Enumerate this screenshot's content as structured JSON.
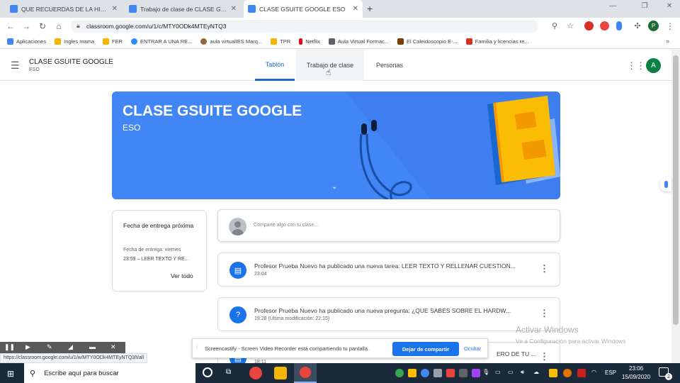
{
  "browser": {
    "tabs": [
      {
        "title": "QUE RECUERDAS DE LA HISTORIA",
        "color": "#4285f4"
      },
      {
        "title": "Trabajo de clase de CLASE GSUITE",
        "color": "#4285f4"
      },
      {
        "title": "CLASE GSUITE GOOGLE ESO",
        "color": "#4285f4"
      }
    ],
    "new_tab": "+",
    "url": "classroom.google.com/u/1/c/MTY0ODk4MTEyNTQ3",
    "profile_initial": "P",
    "bookmarks": [
      {
        "label": "Aplicaciones",
        "color": "#4285f4"
      },
      {
        "label": "Ingles mama",
        "color": "#f4b400"
      },
      {
        "label": "FER",
        "color": "#f4b400"
      },
      {
        "label": "ENTRAR A UNA RE...",
        "color": "#2d8cff"
      },
      {
        "label": "aula virtualIES Marq...",
        "color": "#8e6a3b"
      },
      {
        "label": "TPR",
        "color": "#f4b400"
      },
      {
        "label": "Netflix",
        "color": "#e50914"
      },
      {
        "label": "Aula Virtual Formac...",
        "color": "#5f6368"
      },
      {
        "label": "El Caleidoscopio E-...",
        "color": "#7b3f00"
      },
      {
        "label": "Familia y licencias re...",
        "color": "#d93025"
      }
    ]
  },
  "classroom": {
    "class_name": "CLASE GSUITE GOOGLE",
    "section": "ESO",
    "tabs": [
      "Tablón",
      "Trabajo de clase",
      "Personas"
    ],
    "avatar_initial": "A",
    "banner_title": "CLASE GSUITE GOOGLE",
    "banner_subtitle": "ESO",
    "upcoming": {
      "title": "Fecha de entrega próxima",
      "due": "Fecha de entrega: viernes",
      "item": "23:59 – LEER TEXTO Y RE...",
      "view_all": "Ver todo"
    },
    "share_placeholder": "Comparte algo con tu clase...",
    "posts": [
      {
        "text": "Profesor Prueba Nuevo ha publicado una nueva tarea: LEER TEXTO Y RELLENAR CUESTION...",
        "time": "23:04"
      },
      {
        "text": "Profesor Prueba Nuevo ha publicado una nueva pregunta: ¿QUE SABES SOBRE EL HARDW...",
        "time": "19:28 (Última modificación: 22:15)"
      },
      {
        "text": "ERO DE TU ...",
        "time": "18:11"
      }
    ]
  },
  "screencastify": {
    "message": "Screencastify - Screen Video Recorder está compartiendo tu pantalla.",
    "stop_label": "Dejar de compartir",
    "hide_label": "Ocultar"
  },
  "status_url": "https://classroom.google.com/u/1/w/MTY0ODk4MTEyNTQ3/t/all",
  "watermark": {
    "title": "Activar Windows",
    "subtitle": "Ve a Configuración para activar Windows"
  },
  "taskbar": {
    "search_placeholder": "Escribe aquí para buscar",
    "lang": "ESP",
    "time": "23:06",
    "date": "15/09/2020",
    "notification_count": "2"
  }
}
